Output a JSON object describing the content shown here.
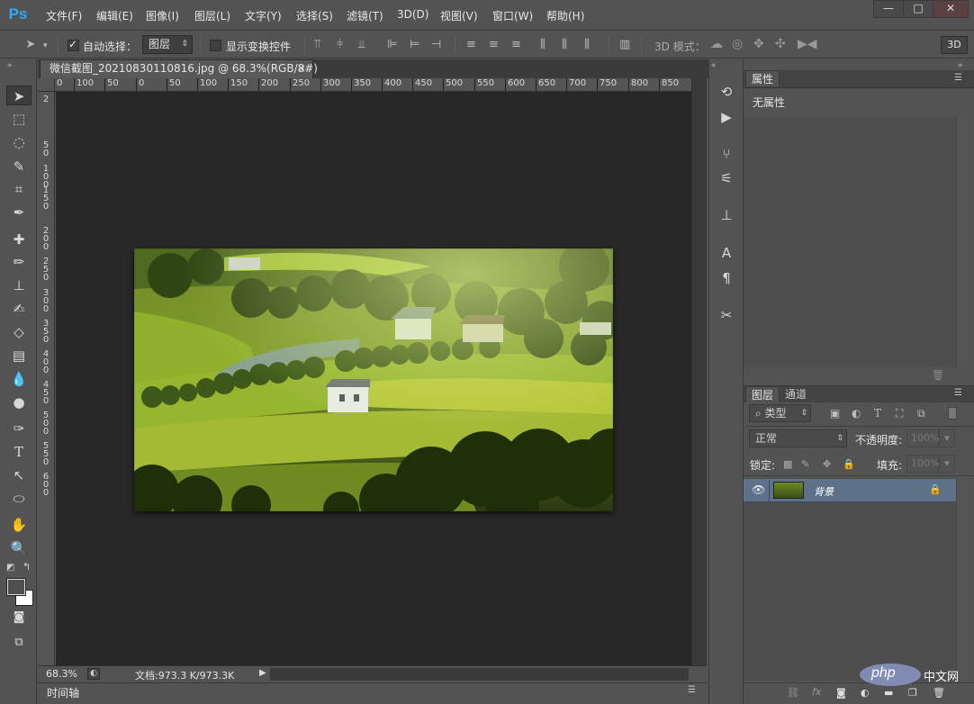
{
  "app": {
    "logo": "Ps"
  },
  "menu": [
    "文件(F)",
    "编辑(E)",
    "图像(I)",
    "图层(L)",
    "文字(Y)",
    "选择(S)",
    "滤镜(T)",
    "3D(D)",
    "视图(V)",
    "窗口(W)",
    "帮助(H)"
  ],
  "window_controls": {
    "minimize": "—",
    "maximize": "□",
    "close": "✕"
  },
  "options": {
    "auto_select_label": "自动选择：",
    "auto_select_checked": true,
    "target_value": "图层",
    "show_transform_label": "显示变换控件",
    "show_transform_checked": false,
    "mode_3d_label": "3D 模式：",
    "btn_3d": "3D"
  },
  "document": {
    "tab_title": "微信截图_20210830110816.jpg @ 68.3%(RGB/8#)",
    "close_glyph": "×",
    "ruler_h": [
      "0",
      "100",
      "50",
      "0",
      "50",
      "100",
      "150",
      "200",
      "250",
      "300",
      "350",
      "400",
      "450",
      "500",
      "550",
      "600",
      "650",
      "700",
      "750",
      "800",
      "850"
    ],
    "ruler_v": [
      "2",
      "5",
      "0",
      "1",
      "0",
      "0",
      "1",
      "5",
      "0",
      "2",
      "0",
      "0",
      "2",
      "5",
      "0",
      "3",
      "0",
      "0",
      "3",
      "5",
      "0",
      "4",
      "0",
      "0",
      "4",
      "5",
      "0",
      "5",
      "0",
      "0",
      "5",
      "5",
      "0",
      "6",
      "0",
      "0"
    ],
    "zoom": "68.3%",
    "doc_size": "文档:973.3 K/973.3K"
  },
  "timeline": {
    "label": "时间轴"
  },
  "properties": {
    "tab": "属性",
    "content": "无属性"
  },
  "layers_panel": {
    "tabs": [
      "图层",
      "通道"
    ],
    "filter_kind": "类型",
    "blend_mode": "正常",
    "opacity_label": "不透明度:",
    "opacity_value": "100%",
    "lock_label": "锁定:",
    "fill_label": "填充:",
    "fill_value": "100%",
    "layers": [
      {
        "name": "背景",
        "visible": true,
        "locked": true
      }
    ]
  },
  "watermark": {
    "text": "php",
    "suffix": "中文网"
  },
  "colors": {
    "accent": "#31a8ff",
    "selected_layer": "#5d7289",
    "canvas_bg": "#282828"
  }
}
